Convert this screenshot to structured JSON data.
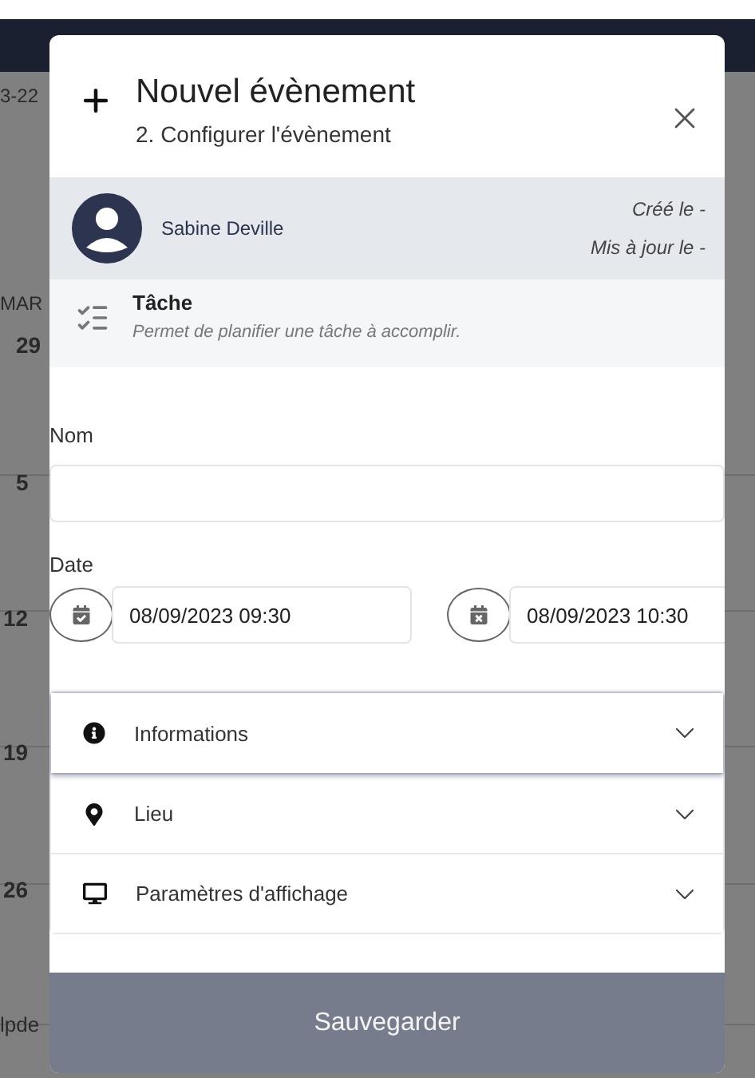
{
  "background": {
    "date_range": "3-22",
    "weekday": "MAR",
    "days": [
      "29",
      "5",
      "12",
      "19",
      "26"
    ],
    "footer": "lpde"
  },
  "modal": {
    "title": "Nouvel évènement",
    "subtitle": "2. Configurer l'évènement",
    "author": {
      "name": "Sabine Deville",
      "created": "Créé le -",
      "updated": "Mis à jour le -"
    },
    "event_type": {
      "title": "Tâche",
      "description": "Permet de planifier une tâche à accomplir."
    },
    "name_field": {
      "label": "Nom"
    },
    "date_field": {
      "label": "Date",
      "start": "08/09/2023 09:30",
      "end": "08/09/2023 10:30"
    },
    "sections": [
      {
        "kind": "info",
        "label": "Informations",
        "selected": true,
        "expanded": false
      },
      {
        "kind": "location",
        "label": "Lieu",
        "selected": false,
        "expanded": false
      },
      {
        "kind": "display",
        "label": "Paramètres d'affichage",
        "selected": false,
        "expanded": false
      }
    ],
    "save_button": "Sauvegarder"
  }
}
